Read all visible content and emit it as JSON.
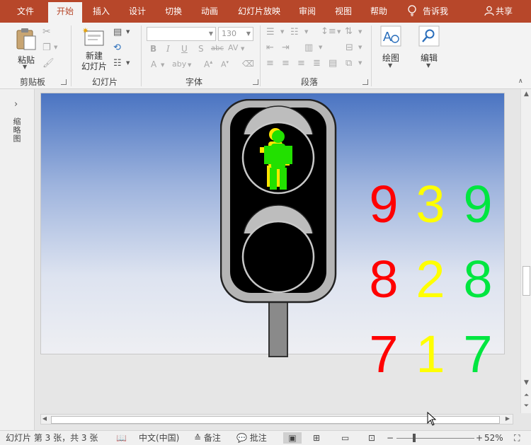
{
  "tabs": [
    {
      "label": "文件",
      "active": false
    },
    {
      "label": "开始",
      "active": true
    },
    {
      "label": "插入",
      "active": false
    },
    {
      "label": "设计",
      "active": false
    },
    {
      "label": "切换",
      "active": false
    },
    {
      "label": "动画",
      "active": false
    },
    {
      "label": "幻灯片放映",
      "active": false
    },
    {
      "label": "审阅",
      "active": false
    },
    {
      "label": "视图",
      "active": false
    },
    {
      "label": "帮助",
      "active": false
    }
  ],
  "tell_me": "告诉我",
  "share": "共享",
  "ribbon": {
    "clipboard": {
      "paste": "粘贴",
      "group": "剪贴板"
    },
    "slides": {
      "new_slide_line1": "新建",
      "new_slide_line2": "幻灯片",
      "group": "幻灯片"
    },
    "font": {
      "font_name": "",
      "font_size": "130",
      "group": "字体"
    },
    "paragraph": {
      "group": "段落"
    },
    "drawing": {
      "label": "绘图"
    },
    "editing": {
      "label": "编辑"
    }
  },
  "thumbnail_pane": {
    "label": "缩略图"
  },
  "slide": {
    "digits": [
      {
        "text": "9",
        "color": "#ff0000"
      },
      {
        "text": "3",
        "color": "#ffff00"
      },
      {
        "text": "9",
        "color": "#00e640"
      },
      {
        "text": "8",
        "color": "#ff0000"
      },
      {
        "text": "2",
        "color": "#ffff00"
      },
      {
        "text": "8",
        "color": "#00e640"
      },
      {
        "text": "7",
        "color": "#ff0000"
      },
      {
        "text": "1",
        "color": "#ffff00"
      },
      {
        "text": "7",
        "color": "#00e640"
      }
    ]
  },
  "status": {
    "slide_info": "幻灯片 第 3 张，共 3 张",
    "language": "中文(中国)",
    "notes": "备注",
    "comments": "批注",
    "zoom": "52%"
  },
  "colors": {
    "accent": "#b7472a",
    "ribbon_bg": "#f3f3f3"
  }
}
